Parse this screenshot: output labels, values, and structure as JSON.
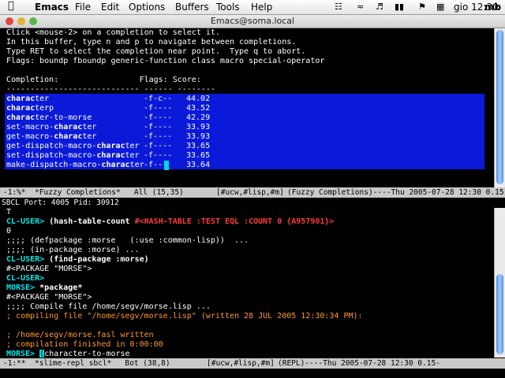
{
  "menubar": {
    "app_name": "Emacs",
    "items": [
      "File",
      "Edit",
      "Options",
      "Buffers",
      "Tools",
      "Help"
    ],
    "clock": "gio 12:30",
    "user": "mb"
  },
  "window": {
    "title": "Emacs@soma.local"
  },
  "fuzzy_buffer": {
    "instructions": [
      "Click <mouse-2> on a completion to select it.",
      "In this buffer, type n and p to navigate between completions.",
      "Type RET to select the completion near point.  Type q to abort.",
      "Flags: boundp fboundp generic-function class macro special-operator"
    ],
    "header": "Completion:                 Flags: Score:",
    "separator": "---------------------------- ------ --------",
    "completions": [
      {
        "prefix": "",
        "match": "charac",
        "suffix": "ter",
        "flags": "-f-c--",
        "score": "44.02"
      },
      {
        "prefix": "",
        "match": "charac",
        "suffix": "terp",
        "flags": "-f----",
        "score": "43.52"
      },
      {
        "prefix": "",
        "match": "charac",
        "suffix": "ter-to-morse",
        "flags": "-f----",
        "score": "42.29"
      },
      {
        "prefix": "set-macro-",
        "match": "charac",
        "suffix": "ter",
        "flags": "-f----",
        "score": "33.93"
      },
      {
        "prefix": "get-macro-",
        "match": "charac",
        "suffix": "ter",
        "flags": "-f----",
        "score": "33.93"
      },
      {
        "prefix": "get-dispatch-macro-",
        "match": "charac",
        "suffix": "ter",
        "flags": "-f----",
        "score": "33.65"
      },
      {
        "prefix": "set-dispatch-macro-",
        "match": "charac",
        "suffix": "ter",
        "flags": "-f----",
        "score": "33.65"
      },
      {
        "prefix": "make-dispatch-macro-",
        "match": "charac",
        "suffix": "ter",
        "flags": "-f---",
        "score": "33.64"
      }
    ]
  },
  "modeline_top": {
    "left": "-1:%*  *Fuzzy Completions*   All (15,35)",
    "minor": "[#ucw,#lisp,#m]",
    "right": "(Fuzzy Completions)----Thu 2005-07-28 12:30 0.15-"
  },
  "info_line": "SBCL  Port: 4005  Pid: 30912",
  "repl": {
    "t_line": "T",
    "prompt1": "CL-USER>",
    "cmd1": "(hash-table-count",
    "result1": "#<HASH-TABLE :TEST EQL :COUNT 0 {A957901}>",
    "zero": "0",
    "defpackage": ";;;; (defpackage :morse   (:use :common-lisp))  ...",
    "inpackage": ";;;; (in-package :morse) ...",
    "prompt2": "CL-USER>",
    "cmd2": "(find-package :morse)",
    "pkg1": "#<PACKAGE \"MORSE\">",
    "prompt3": "CL-USER>",
    "prompt4": "MORSE>",
    "cmd4": "*package*",
    "pkg2": "#<PACKAGE \"MORSE\">",
    "compile1": ";;;; Compile file /home/segv/morse.lisp ...",
    "compile2": "; compiling file \"/home/segv/morse.lisp\" (written 28 JUL 2005 12:30:34 PM):",
    "fasl": "; /home/segv/morse.fasl written",
    "finished": "; compilation finished in 0:00:00",
    "prompt5": "MORSE>",
    "input_cursor": "(",
    "input_rest": "character-to-morse"
  },
  "modeline_bottom": {
    "left": "-1:**  *slime-repl sbcl*   Bot (38,8)",
    "minor": "[#ucw,#lisp,#m]",
    "right": "(REPL)----Thu 2005-07-28 12:30 0.15-"
  },
  "colors": {
    "highlight": "#0b1ad8",
    "prompt": "#00e6e6",
    "error": "#ff3a3a",
    "compile_note": "#ff9a2a"
  }
}
